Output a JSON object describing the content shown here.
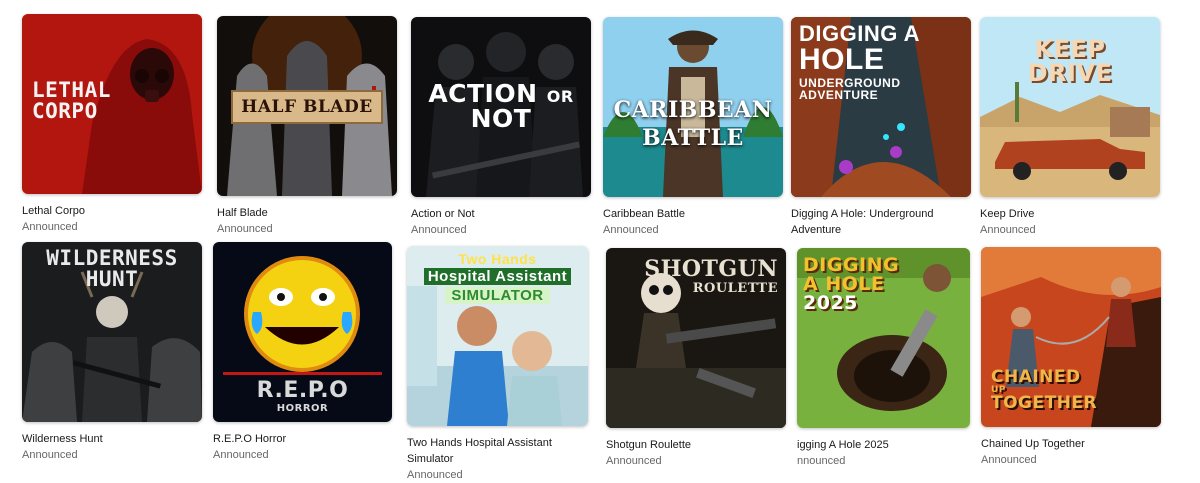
{
  "games": [
    {
      "title": "Lethal Corpo",
      "status": "Announced",
      "cover_lines": [
        "LETHAL",
        "CORPO"
      ],
      "cover_icon": "gas-mask-figure",
      "colors": {
        "bg1": "#9b0f0f",
        "bg2": "#d8271f",
        "text": "#f3f3f3"
      }
    },
    {
      "title": "Half Blade",
      "status": "Announced",
      "cover_lines": [
        "HALF BLADE"
      ],
      "cover_icon": "armored-knights",
      "colors": {
        "bg1": "#4a1808",
        "bg2": "#0e0c0b",
        "text": "#2a1207"
      }
    },
    {
      "title": "Action or Not",
      "status": "Announced",
      "cover_lines": [
        "ACTION",
        "OR",
        "NOT"
      ],
      "cover_icon": "tactical-soldiers",
      "colors": {
        "bg1": "#2a2c30",
        "bg2": "#0b0b0d",
        "text": "#ffffff"
      }
    },
    {
      "title": "Caribbean Battle",
      "status": "Announced",
      "cover_lines": [
        "CARIBBEAN",
        "BATTLE"
      ],
      "cover_icon": "pirate-captain",
      "colors": {
        "bg1": "#6bb8e0",
        "bg2": "#1b6f78",
        "text": "#ffffff"
      }
    },
    {
      "title": "Digging A Hole: Underground Adventure",
      "status": "",
      "cover_lines": [
        "DIGGING A",
        "HOLE",
        "UNDERGROUND",
        "ADVENTURE"
      ],
      "cover_icon": "cave-crystals",
      "colors": {
        "bg1": "#7a2c14",
        "bg2": "#21343d",
        "text": "#ffffff"
      }
    },
    {
      "title": "Keep Drive",
      "status": "Announced",
      "cover_lines": [
        "KEEP",
        "DRIVE"
      ],
      "cover_icon": "rusty-car-desert",
      "colors": {
        "bg1": "#bfe7f5",
        "bg2": "#d9b77c",
        "text": "#f4d7b4"
      }
    },
    {
      "title": "Wilderness Hunt",
      "status": "Announced",
      "cover_lines": [
        "WILDERNESS HUNT"
      ],
      "cover_icon": "hunter-and-wolves",
      "colors": {
        "bg1": "#2d3031",
        "bg2": "#121314",
        "text": "#e9e9e9"
      }
    },
    {
      "title": "R.E.P.O Horror",
      "status": "Announced",
      "cover_lines": [
        "R.E.P.O",
        "HORROR"
      ],
      "cover_icon": "scary-emoji-face",
      "colors": {
        "bg1": "#0a1020",
        "bg2": "#02050c",
        "text": "#d9d9d9"
      }
    },
    {
      "title": "Two Hands Hospital Assistant Simulator",
      "status": "Announced",
      "cover_lines": [
        "Two Hands",
        "Hospital Assistant",
        "SIMULATOR"
      ],
      "cover_icon": "doctor-and-patient",
      "colors": {
        "bg1": "#b9dbe6",
        "bg2": "#e6f1f3",
        "text": "#ffffff"
      }
    },
    {
      "title": "Shotgun Roulette",
      "status": "Announced",
      "cover_lines": [
        "SHOTGUN",
        "ROULETTE"
      ],
      "cover_icon": "skull-with-shotgun",
      "colors": {
        "bg1": "#3a3326",
        "bg2": "#15120d",
        "text": "#e8e1d2"
      }
    },
    {
      "title": "igging A Hole 2025",
      "status": "nnounced",
      "cover_lines": [
        "DIGGING",
        "A HOLE",
        "2025"
      ],
      "cover_icon": "drill-pit",
      "colors": {
        "bg1": "#79b13f",
        "bg2": "#4c7a25",
        "text": "#f2c12e"
      }
    },
    {
      "title": "Chained Up Together",
      "status": "Announced",
      "cover_lines": [
        "CHAINED",
        "UP",
        "TOGETHER"
      ],
      "cover_icon": "climbers-on-cliff",
      "colors": {
        "bg1": "#c8461e",
        "bg2": "#3a1a0c",
        "text": "#f1b64a"
      }
    }
  ]
}
